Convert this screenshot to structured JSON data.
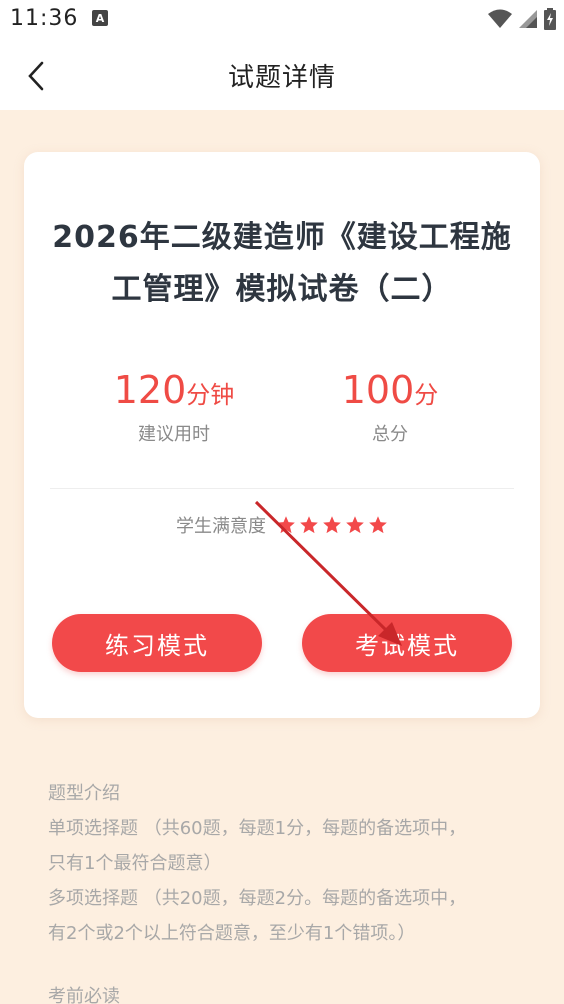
{
  "status_bar": {
    "time": "11:36",
    "notification_badge": "A"
  },
  "header": {
    "title": "试题详情"
  },
  "exam": {
    "title_line1": "2026年二级建造师《建设工程施",
    "title_line2": "工管理》模拟试卷（二）",
    "duration": {
      "number": "120",
      "unit": "分钟",
      "label": "建议用时"
    },
    "score": {
      "number": "100",
      "unit": "分",
      "label": "总分"
    },
    "rating": {
      "label": "学生满意度",
      "stars": 5
    },
    "buttons": {
      "practice": "练习模式",
      "exam": "考试模式"
    }
  },
  "intro": {
    "heading": "题型介绍",
    "single_choice": "单项选择题 （共60题，每题1分，每题的备选项中，",
    "single_choice_cont": "只有1个最符合题意）",
    "multi_choice": "多项选择题 （共20题，每题2分。每题的备选项中，",
    "multi_choice_cont": "有2个或2个以上符合题意，至少有1个错项。）",
    "notes_heading": "考前必读"
  },
  "colors": {
    "accent": "#f2494a",
    "background": "#fdefe0",
    "title": "#2e3640"
  },
  "icons": [
    "back-chevron-icon",
    "wifi-icon",
    "signal-icon",
    "battery-icon",
    "star-icon"
  ]
}
